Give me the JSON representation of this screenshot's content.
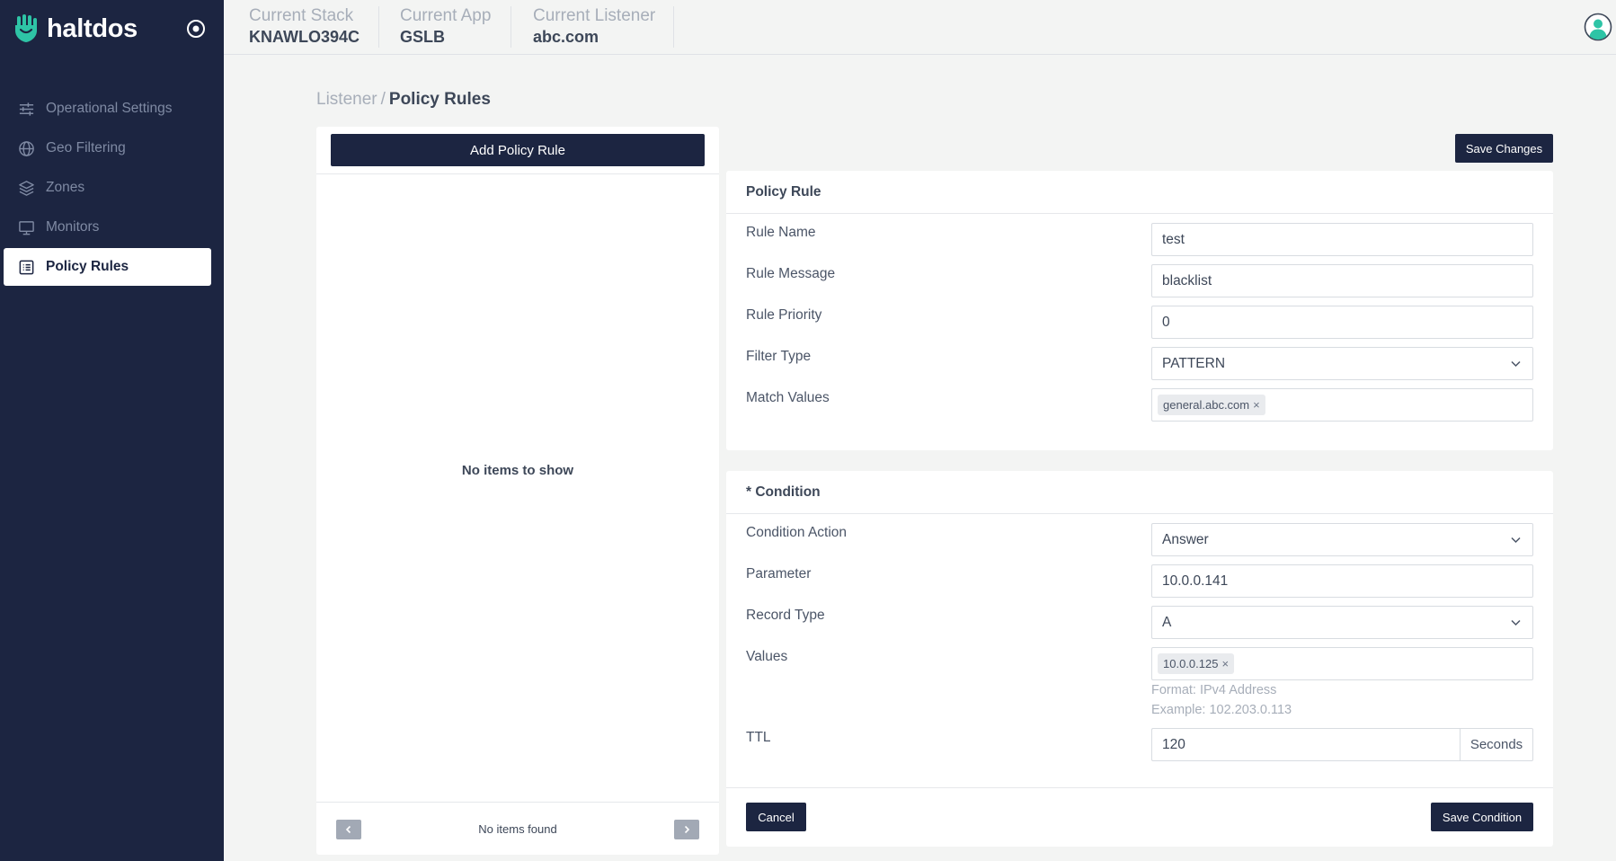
{
  "brand": {
    "name": "haltdos"
  },
  "sidebar": {
    "items": [
      {
        "label": "Operational Settings",
        "icon": "sliders-icon",
        "active": false
      },
      {
        "label": "Geo Filtering",
        "icon": "globe-icon",
        "active": false
      },
      {
        "label": "Zones",
        "icon": "layers-icon",
        "active": false
      },
      {
        "label": "Monitors",
        "icon": "monitor-icon",
        "active": false
      },
      {
        "label": "Policy Rules",
        "icon": "list-icon",
        "active": true
      }
    ]
  },
  "header": {
    "stack": {
      "label": "Current Stack",
      "value": "KNAWLO394C"
    },
    "app": {
      "label": "Current App",
      "value": "GSLB"
    },
    "listener": {
      "label": "Current Listener",
      "value": "abc.com"
    }
  },
  "breadcrumb": {
    "parent": "Listener",
    "separator": "/",
    "current": "Policy Rules"
  },
  "list_panel": {
    "add_label": "Add Policy Rule",
    "empty_message": "No items to show",
    "pager_text": "No items found"
  },
  "toolbar": {
    "save_changes_label": "Save Changes"
  },
  "policy_rule": {
    "title": "Policy Rule",
    "rule_name": {
      "label": "Rule Name",
      "value": "test"
    },
    "rule_message": {
      "label": "Rule Message",
      "value": "blacklist"
    },
    "rule_priority": {
      "label": "Rule Priority",
      "value": "0"
    },
    "filter_type": {
      "label": "Filter Type",
      "value": "PATTERN"
    },
    "match_values": {
      "label": "Match Values",
      "tags": [
        "general.abc.com"
      ]
    }
  },
  "condition": {
    "title": "* Condition",
    "action": {
      "label": "Condition Action",
      "value": "Answer"
    },
    "parameter": {
      "label": "Parameter",
      "value": "10.0.0.141"
    },
    "record_type": {
      "label": "Record Type",
      "value": "A"
    },
    "values": {
      "label": "Values",
      "tags": [
        "10.0.0.125"
      ],
      "hint_format": "Format: IPv4 Address",
      "hint_example": "Example: 102.203.0.113"
    },
    "ttl": {
      "label": "TTL",
      "value": "120",
      "unit": "Seconds"
    },
    "cancel_label": "Cancel",
    "save_label": "Save Condition"
  },
  "colors": {
    "sidebar_bg": "#1c2541",
    "button_bg": "#1c2541",
    "page_bg": "#f3f4f3",
    "brand_accent": "#2ec4a6"
  }
}
